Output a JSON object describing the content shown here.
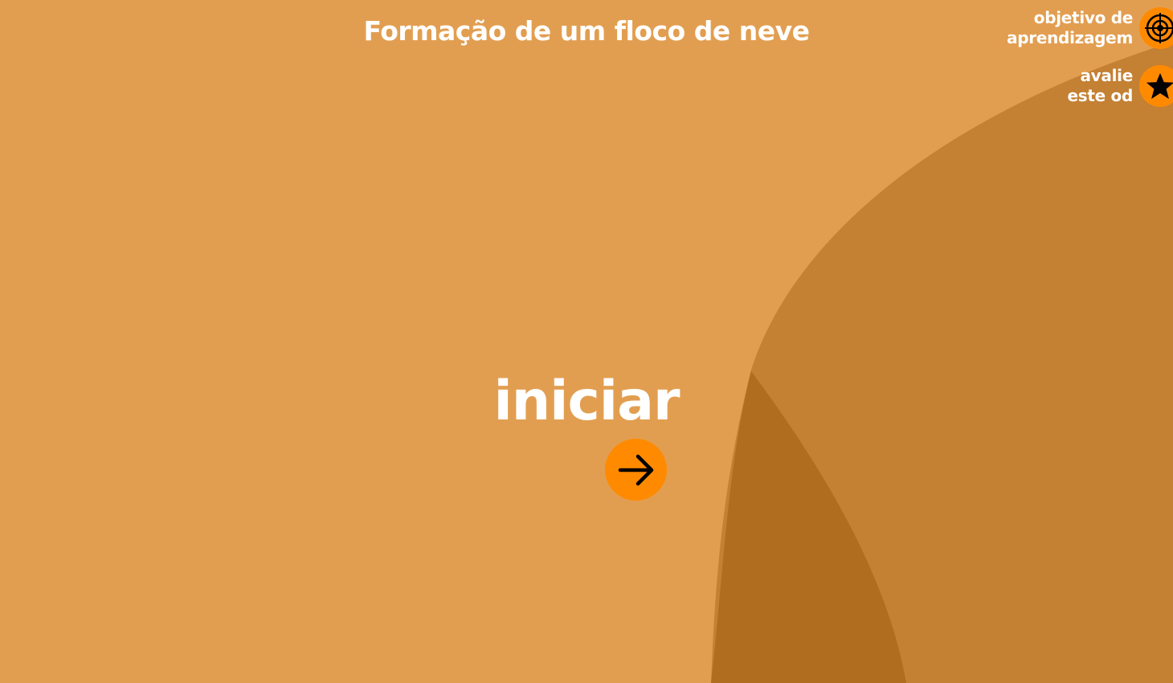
{
  "header": {
    "title": "Formação de um floco de neve"
  },
  "side_links": {
    "objective": {
      "line1": "objetivo de",
      "line2": "aprendizagem",
      "icon": "target-icon"
    },
    "rate": {
      "line1": "avalie",
      "line2": "este od",
      "icon": "star-icon"
    }
  },
  "main": {
    "start_label": "iniciar",
    "start_icon": "arrow-right-icon"
  },
  "colors": {
    "background": "#e29e50",
    "shape_mid": "#c48033",
    "shape_dark": "#b06d1f",
    "accent": "#ff8a00",
    "text": "#ffffff",
    "icon": "#000000"
  }
}
